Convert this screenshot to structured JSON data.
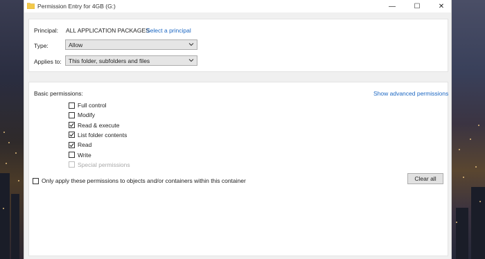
{
  "window": {
    "title": "Permission Entry for 4GB (G:)",
    "minimize_glyph": "—",
    "maximize_glyph": "☐",
    "close_glyph": "✕"
  },
  "principal": {
    "label": "Principal:",
    "value": "ALL APPLICATION PACKAGES",
    "select_link": "Select a principal"
  },
  "type": {
    "label": "Type:",
    "value": "Allow"
  },
  "applies_to": {
    "label": "Applies to:",
    "value": "This folder, subfolders and files"
  },
  "basic": {
    "heading": "Basic permissions:",
    "advanced_link": "Show advanced permissions",
    "items": [
      {
        "label": "Full control",
        "checked": false,
        "disabled": false
      },
      {
        "label": "Modify",
        "checked": false,
        "disabled": false
      },
      {
        "label": "Read & execute",
        "checked": true,
        "disabled": false
      },
      {
        "label": "List folder contents",
        "checked": true,
        "disabled": false
      },
      {
        "label": "Read",
        "checked": true,
        "disabled": false
      },
      {
        "label": "Write",
        "checked": false,
        "disabled": false
      },
      {
        "label": "Special permissions",
        "checked": false,
        "disabled": true
      }
    ]
  },
  "only_apply": {
    "label": "Only apply these permissions to objects and/or containers within this container",
    "checked": false
  },
  "clear_all_label": "Clear all",
  "colors": {
    "link": "#1a66c2",
    "folder_icon": "#f3c94a",
    "dialog_bg": "#f0f0f0"
  },
  "icons": {
    "title": "folder-icon",
    "combo": "chevron-down-icon",
    "check": "checkmark-icon"
  }
}
